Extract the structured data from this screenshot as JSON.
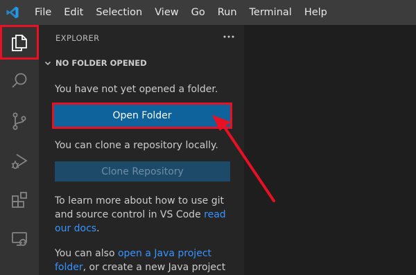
{
  "menubar": {
    "logo_icon": "vscode-logo-icon",
    "items": [
      "File",
      "Edit",
      "Selection",
      "View",
      "Go",
      "Run",
      "Terminal",
      "Help"
    ]
  },
  "activitybar": {
    "items": [
      {
        "icon": "explorer-icon",
        "active": true
      },
      {
        "icon": "search-icon",
        "active": false
      },
      {
        "icon": "source-control-icon",
        "active": false
      },
      {
        "icon": "run-debug-icon",
        "active": false
      },
      {
        "icon": "extensions-icon",
        "active": false
      },
      {
        "icon": "remote-explorer-icon",
        "active": false
      }
    ]
  },
  "sidebar": {
    "header": "EXPLORER",
    "more_icon": "ellipsis-icon",
    "section_title": "NO FOLDER OPENED",
    "not_opened_text": "You have not yet opened a folder.",
    "open_folder_label": "Open Folder",
    "clone_text": "You can clone a repository locally.",
    "clone_button_label": "Clone Repository",
    "git_text_before": "To learn more about how to use git and source control in VS Code ",
    "git_link": "read our docs",
    "git_text_after": ".",
    "java_text_before": "You can also ",
    "java_link": "open a Java project folder",
    "java_text_after": ", or create a new Java project"
  },
  "colors": {
    "menubar_bg": "#3c3c3c",
    "activitybar_bg": "#333333",
    "sidebar_bg": "#252526",
    "editor_bg": "#1e1e1e",
    "button_primary": "#0e639c",
    "link": "#3794ff",
    "highlight": "#e81123"
  }
}
